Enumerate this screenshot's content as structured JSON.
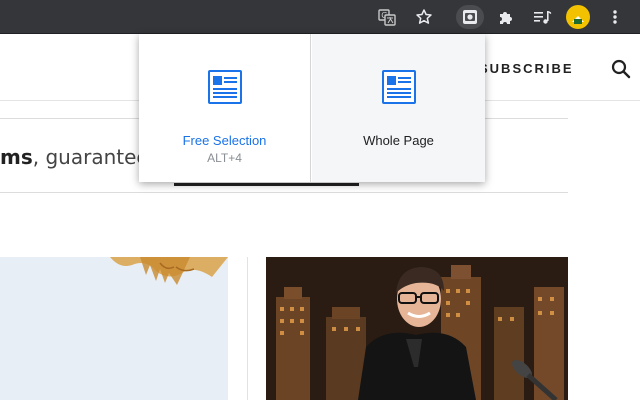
{
  "toolbar": {
    "icons": [
      "translate-icon",
      "bookmark-star-icon",
      "screenshot-extension-icon",
      "extensions-puzzle-icon",
      "media-control-icon",
      "profile-avatar",
      "more-menu-icon"
    ]
  },
  "site": {
    "subscribe_label": "SUBSCRIBE",
    "tagline_bold": "ms",
    "tagline_rest": ", guaranteed"
  },
  "popup": {
    "options": [
      {
        "label": "Free Selection",
        "shortcut": "ALT+4"
      },
      {
        "label": "Whole Page",
        "shortcut": ""
      }
    ],
    "accent_color": "#1a73e8"
  },
  "colors": {
    "toolbar_bg": "#35363a",
    "avatar_yellow": "#f2c200"
  }
}
